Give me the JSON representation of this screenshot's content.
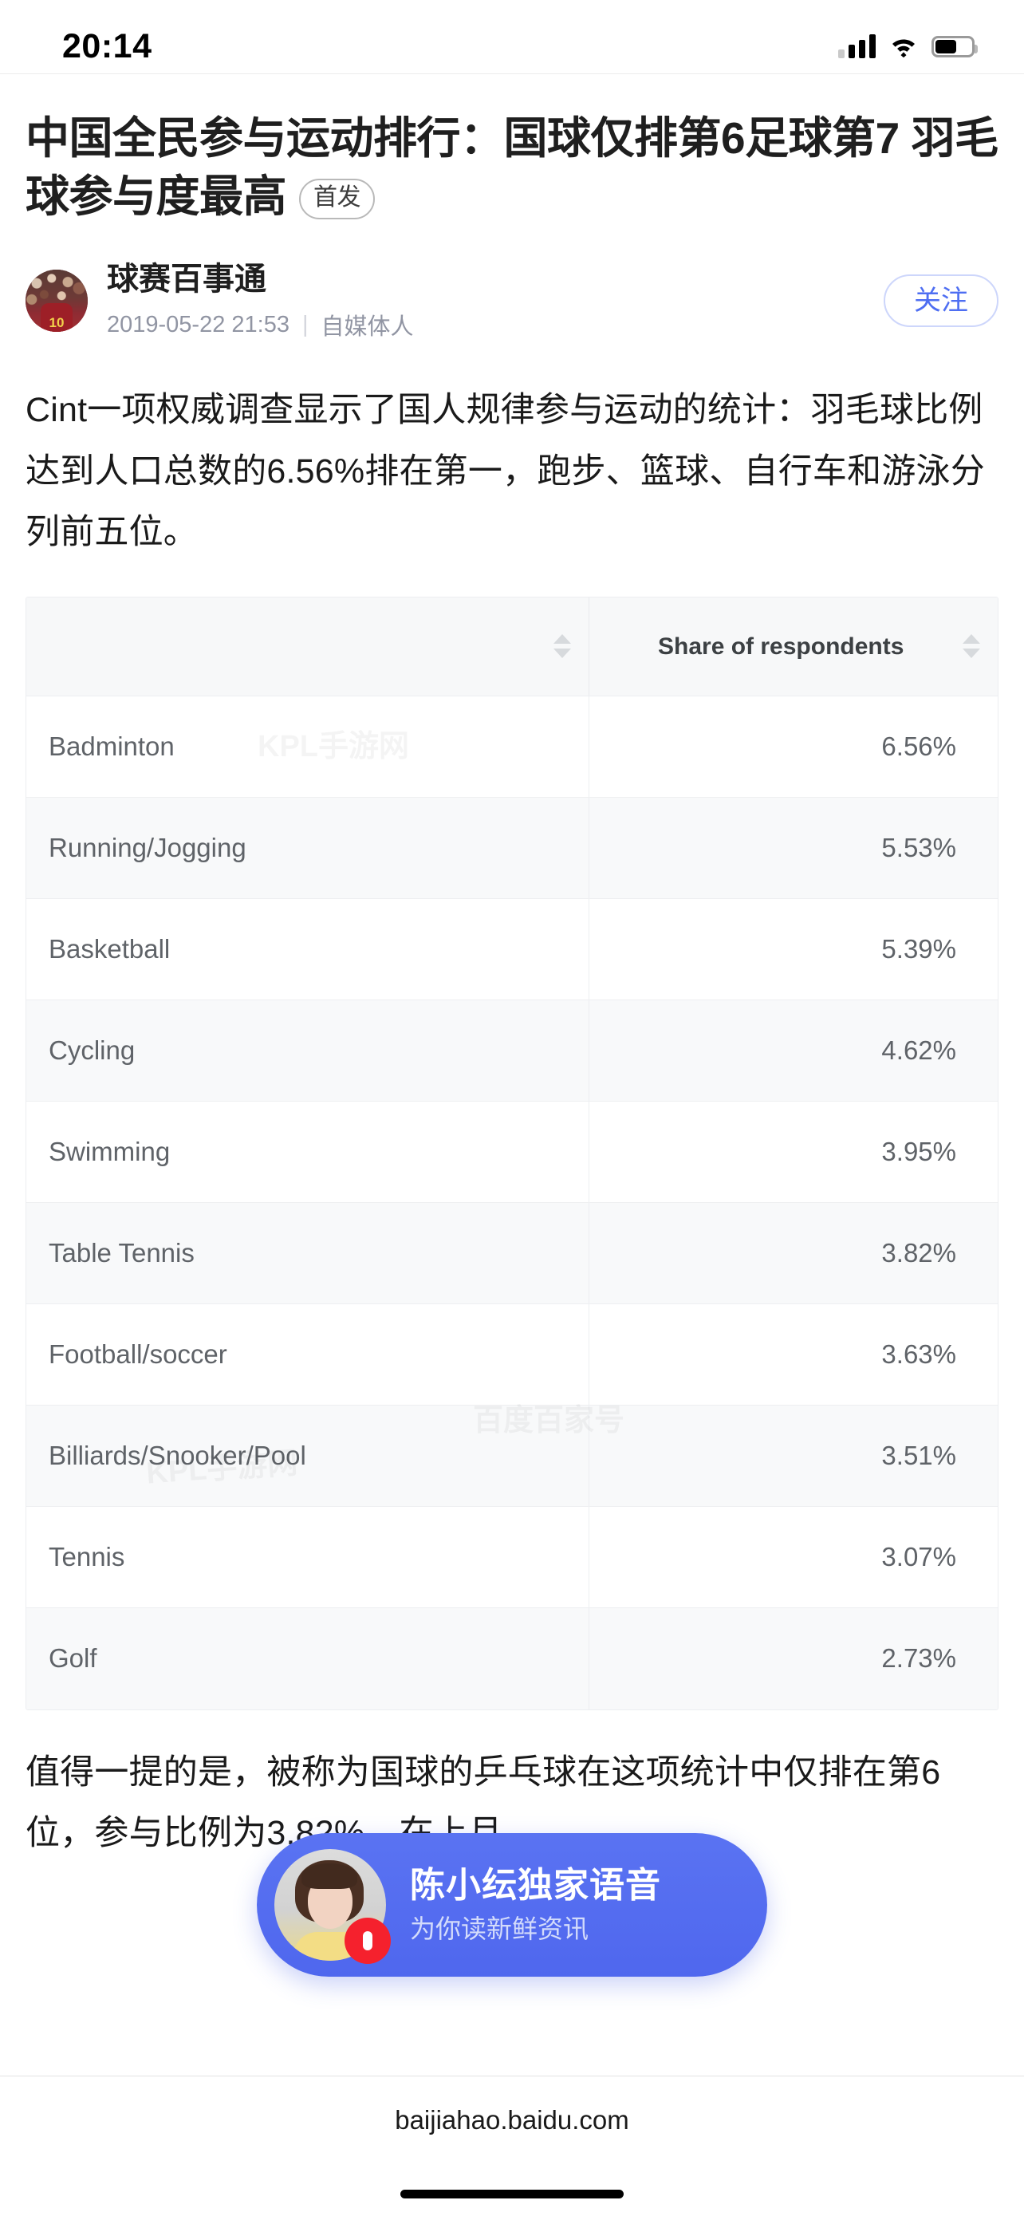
{
  "status_bar": {
    "time": "20:14",
    "signal_icon": "cellular-signal-icon",
    "wifi_icon": "wifi-icon",
    "battery_icon": "battery-icon"
  },
  "article": {
    "headline": "中国全民参与运动排行：国球仅排第6足球第7 羽毛球参与度最高",
    "badge": "首发",
    "author": {
      "name": "球赛百事通",
      "avatar_number": "10",
      "timestamp": "2019-05-22 21:53",
      "separator": "|",
      "role": "自媒体人",
      "follow_label": "关注"
    },
    "paragraph_1": "Cint一项权威调查显示了国人规律参与运动的统计：羽毛球比例达到人口总数的6.56%排在第一，跑步、篮球、自行车和游泳分列前五位。",
    "paragraph_2": "值得一提的是，被称为国球的乒乓球在这项统计中仅排在第6位，参与比例为3.82%。在上月"
  },
  "watermark": {
    "text_1": "KPL手游网",
    "text_2": "百度百家号",
    "text_3": "KPL手游网"
  },
  "chart_data": {
    "type": "table",
    "title": "",
    "columns": [
      "",
      "Share of respondents"
    ],
    "categories": [
      "Badminton",
      "Running/Jogging",
      "Basketball",
      "Cycling",
      "Swimming",
      "Table Tennis",
      "Football/soccer",
      "Billiards/Snooker/Pool",
      "Tennis",
      "Golf"
    ],
    "values": [
      6.56,
      5.53,
      5.39,
      4.62,
      3.95,
      3.82,
      3.63,
      3.51,
      3.07,
      2.73
    ],
    "value_labels": [
      "6.56%",
      "5.53%",
      "5.39%",
      "4.62%",
      "3.95%",
      "3.82%",
      "3.63%",
      "3.51%",
      "3.07%",
      "2.73%"
    ],
    "xlabel": "",
    "ylabel": "Share of respondents",
    "unit": "%",
    "rows": [
      {
        "name": "Badminton",
        "value": "6.56%"
      },
      {
        "name": "Running/Jogging",
        "value": "5.53%"
      },
      {
        "name": "Basketball",
        "value": "5.39%"
      },
      {
        "name": "Cycling",
        "value": "4.62%"
      },
      {
        "name": "Swimming",
        "value": "3.95%"
      },
      {
        "name": "Table Tennis",
        "value": "3.82%"
      },
      {
        "name": "Football/soccer",
        "value": "3.63%"
      },
      {
        "name": "Billiards/Snooker/Pool",
        "value": "3.51%"
      },
      {
        "name": "Tennis",
        "value": "3.07%"
      },
      {
        "name": "Golf",
        "value": "2.73%"
      }
    ]
  },
  "table": {
    "header_col_1": "",
    "header_col_2": "Share of respondents",
    "sort_icon": "sort-arrows-icon"
  },
  "voice_banner": {
    "title": "陈小纭独家语音",
    "subtitle": "为你读新鲜资讯",
    "badge_icon": "microphone-icon",
    "avatar_icon": "host-avatar"
  },
  "browser": {
    "url": "baijiahao.baidu.com"
  },
  "colors": {
    "accent_blue": "#4e6ef2",
    "banner_blue": "#5a73f2",
    "badge_red": "#f5212d",
    "text_primary": "#1a1a1a",
    "text_muted": "#9195a3",
    "table_alt_row": "#f8f9fa"
  }
}
